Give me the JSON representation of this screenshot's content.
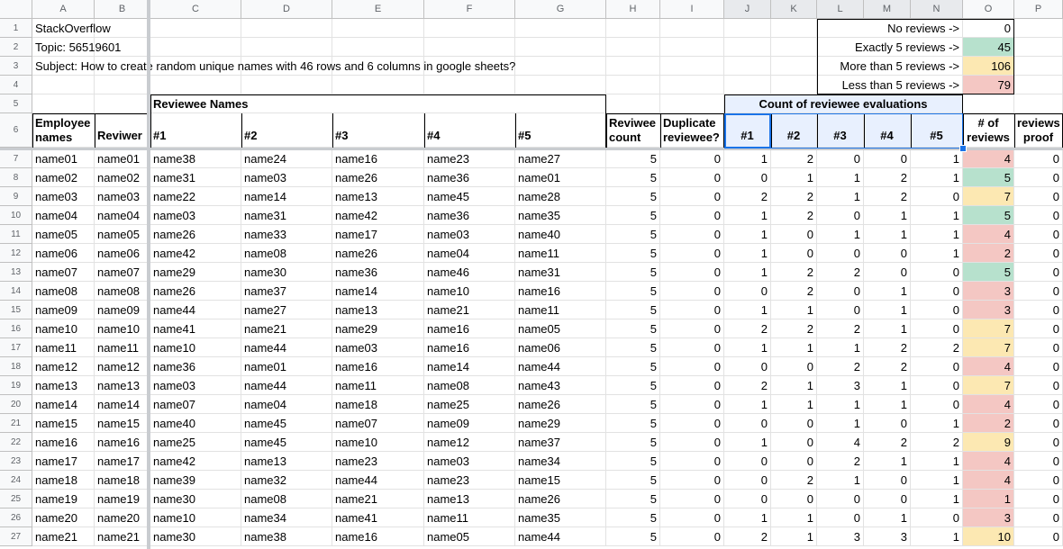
{
  "columns": [
    "A",
    "B",
    "C",
    "D",
    "E",
    "F",
    "G",
    "H",
    "I",
    "J",
    "K",
    "L",
    "M",
    "N",
    "O",
    "P"
  ],
  "title_rows": {
    "r1": "StackOverflow",
    "r2": "Topic: 56519601",
    "r3": "Subject: How to create random unique names with 46 rows and 6 columns in google sheets?"
  },
  "summary": [
    {
      "label": "No reviews ->",
      "value": "0",
      "color": "none"
    },
    {
      "label": "Exactly 5 reviews ->",
      "value": "45",
      "color": "green"
    },
    {
      "label": "More than 5 reviews ->",
      "value": "106",
      "color": "yellow"
    },
    {
      "label": "Less than 5 reviews ->",
      "value": "79",
      "color": "red"
    }
  ],
  "headers": {
    "reviewee_names": "Reviewee Names",
    "count_evals": "Count of reviewee evaluations",
    "employee_l1": "Employee",
    "employee_l2": "names",
    "reviewer": "Reviwer",
    "c1": "#1",
    "c2": "#2",
    "c3": "#3",
    "c4": "#4",
    "c5": "#5",
    "rc_l1": "Reviwee",
    "rc_l2": "count",
    "dup_l1": "Duplicate",
    "dup_l2": "reviewee?",
    "e1": "#1",
    "e2": "#2",
    "e3": "#3",
    "e4": "#4",
    "e5": "#5",
    "nrev_l1": "# of",
    "nrev_l2": "reviews",
    "proof_l1": "reviews",
    "proof_l2": "proof"
  },
  "rows": [
    [
      "name01",
      "name01",
      "name38",
      "name24",
      "name16",
      "name23",
      "name27",
      "5",
      "0",
      "1",
      "2",
      "0",
      "0",
      "1",
      "4",
      "0"
    ],
    [
      "name02",
      "name02",
      "name31",
      "name03",
      "name26",
      "name36",
      "name01",
      "5",
      "0",
      "0",
      "1",
      "1",
      "2",
      "1",
      "5",
      "0"
    ],
    [
      "name03",
      "name03",
      "name22",
      "name14",
      "name13",
      "name45",
      "name28",
      "5",
      "0",
      "2",
      "2",
      "1",
      "2",
      "0",
      "7",
      "0"
    ],
    [
      "name04",
      "name04",
      "name03",
      "name31",
      "name42",
      "name36",
      "name35",
      "5",
      "0",
      "1",
      "2",
      "0",
      "1",
      "1",
      "5",
      "0"
    ],
    [
      "name05",
      "name05",
      "name26",
      "name33",
      "name17",
      "name03",
      "name40",
      "5",
      "0",
      "1",
      "0",
      "1",
      "1",
      "1",
      "4",
      "0"
    ],
    [
      "name06",
      "name06",
      "name42",
      "name08",
      "name26",
      "name04",
      "name11",
      "5",
      "0",
      "1",
      "0",
      "0",
      "0",
      "1",
      "2",
      "0"
    ],
    [
      "name07",
      "name07",
      "name29",
      "name30",
      "name36",
      "name46",
      "name31",
      "5",
      "0",
      "1",
      "2",
      "2",
      "0",
      "0",
      "5",
      "0"
    ],
    [
      "name08",
      "name08",
      "name26",
      "name37",
      "name14",
      "name10",
      "name16",
      "5",
      "0",
      "0",
      "2",
      "0",
      "1",
      "0",
      "3",
      "0"
    ],
    [
      "name09",
      "name09",
      "name44",
      "name27",
      "name13",
      "name21",
      "name11",
      "5",
      "0",
      "1",
      "1",
      "0",
      "1",
      "0",
      "3",
      "0"
    ],
    [
      "name10",
      "name10",
      "name41",
      "name21",
      "name29",
      "name16",
      "name05",
      "5",
      "0",
      "2",
      "2",
      "2",
      "1",
      "0",
      "7",
      "0"
    ],
    [
      "name11",
      "name11",
      "name10",
      "name44",
      "name03",
      "name16",
      "name06",
      "5",
      "0",
      "1",
      "1",
      "1",
      "2",
      "2",
      "7",
      "0"
    ],
    [
      "name12",
      "name12",
      "name36",
      "name01",
      "name16",
      "name14",
      "name44",
      "5",
      "0",
      "0",
      "0",
      "2",
      "2",
      "0",
      "4",
      "0"
    ],
    [
      "name13",
      "name13",
      "name03",
      "name44",
      "name11",
      "name08",
      "name43",
      "5",
      "0",
      "2",
      "1",
      "3",
      "1",
      "0",
      "7",
      "0"
    ],
    [
      "name14",
      "name14",
      "name07",
      "name04",
      "name18",
      "name25",
      "name26",
      "5",
      "0",
      "1",
      "1",
      "1",
      "1",
      "0",
      "4",
      "0"
    ],
    [
      "name15",
      "name15",
      "name40",
      "name45",
      "name07",
      "name09",
      "name29",
      "5",
      "0",
      "0",
      "0",
      "1",
      "0",
      "1",
      "2",
      "0"
    ],
    [
      "name16",
      "name16",
      "name25",
      "name45",
      "name10",
      "name12",
      "name37",
      "5",
      "0",
      "1",
      "0",
      "4",
      "2",
      "2",
      "9",
      "0"
    ],
    [
      "name17",
      "name17",
      "name42",
      "name13",
      "name23",
      "name03",
      "name34",
      "5",
      "0",
      "0",
      "0",
      "2",
      "1",
      "1",
      "4",
      "0"
    ],
    [
      "name18",
      "name18",
      "name39",
      "name32",
      "name44",
      "name23",
      "name15",
      "5",
      "0",
      "0",
      "2",
      "1",
      "0",
      "1",
      "4",
      "0"
    ],
    [
      "name19",
      "name19",
      "name30",
      "name08",
      "name21",
      "name13",
      "name26",
      "5",
      "0",
      "0",
      "0",
      "0",
      "0",
      "1",
      "1",
      "0"
    ],
    [
      "name20",
      "name20",
      "name10",
      "name34",
      "name41",
      "name11",
      "name35",
      "5",
      "0",
      "1",
      "1",
      "0",
      "1",
      "0",
      "3",
      "0"
    ],
    [
      "name21",
      "name21",
      "name30",
      "name38",
      "name16",
      "name05",
      "name44",
      "5",
      "0",
      "2",
      "1",
      "3",
      "3",
      "1",
      "10",
      "0"
    ]
  ]
}
